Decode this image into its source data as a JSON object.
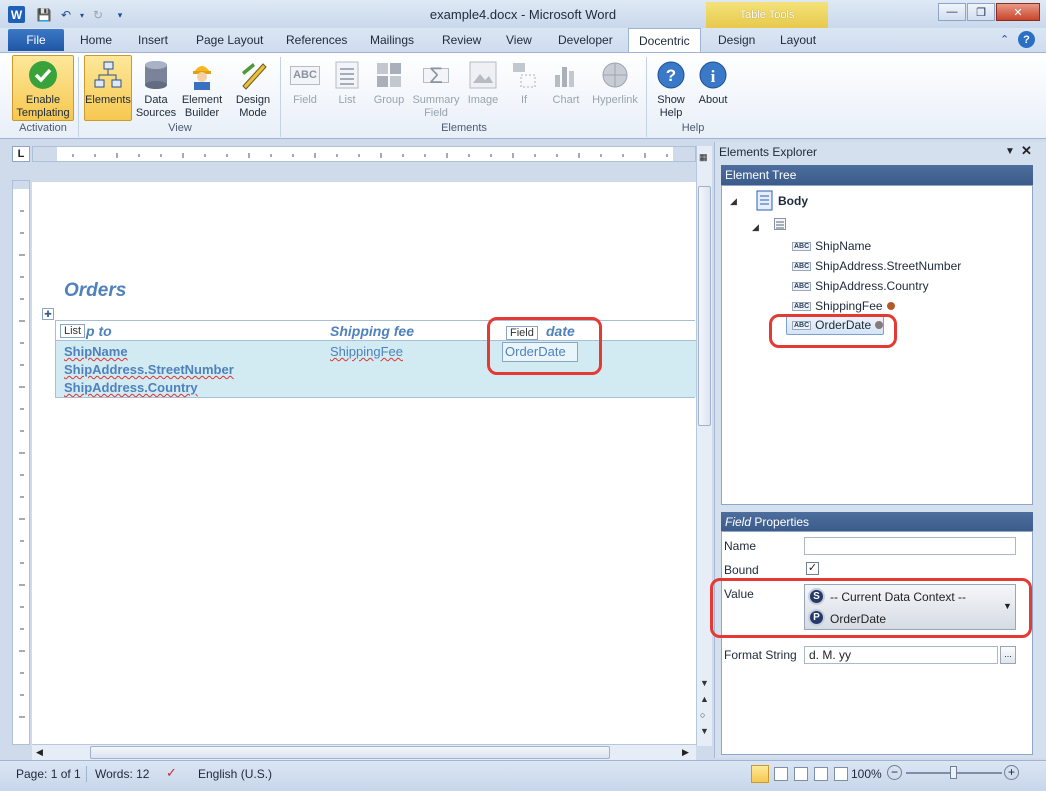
{
  "window": {
    "title": "example4.docx - Microsoft Word",
    "contextual_tab_group": "Table Tools"
  },
  "tabs": [
    "File",
    "Home",
    "Insert",
    "Page Layout",
    "References",
    "Mailings",
    "Review",
    "View",
    "Developer",
    "Docentric",
    "Design",
    "Layout"
  ],
  "ribbon": {
    "groups": {
      "activation": "Activation",
      "view": "View",
      "elements": "Elements",
      "help": "Help"
    },
    "buttons": {
      "enable_templating": [
        "Enable",
        "Templating"
      ],
      "elements": "Elements",
      "data_sources": [
        "Data",
        "Sources"
      ],
      "element_builder": [
        "Element",
        "Builder"
      ],
      "design_mode": [
        "Design",
        "Mode"
      ],
      "field": "Field",
      "list": "List",
      "group": "Group",
      "summary_field": [
        "Summary",
        "Field"
      ],
      "image": "Image",
      "if": "If",
      "chart": "Chart",
      "hyperlink": "Hyperlink",
      "show_help": [
        "Show",
        "Help"
      ],
      "about": "About"
    }
  },
  "document": {
    "heading": "Orders",
    "columns": [
      "p to",
      "Shipping fee",
      "date"
    ],
    "list_tag": "List",
    "field_tag": "Field",
    "ship_fields": [
      "ShipName",
      "ShipAddress.StreetNumber",
      "ShipAddress.Country"
    ],
    "shipping_fee_field": "ShippingFee",
    "order_date_field": "OrderDate"
  },
  "pane": {
    "title": "Elements Explorer",
    "tree_header": "Element Tree",
    "tree_root": "Body",
    "tree_items": [
      "ShipName",
      "ShipAddress.StreetNumber",
      "ShipAddress.Country",
      "ShippingFee",
      "OrderDate"
    ],
    "props_header_italic": "Field",
    "props_header_rest": "Properties",
    "props": {
      "name_label": "Name",
      "name_value": "",
      "bound_label": "Bound",
      "bound_checked": true,
      "value_label": "Value",
      "value_context": "-- Current Data Context --",
      "value_path": "OrderDate",
      "format_label": "Format String",
      "format_value": "d. M. yy"
    }
  },
  "status": {
    "page": "Page: 1 of 1",
    "words": "Words: 12",
    "language": "English (U.S.)",
    "zoom": "100%"
  }
}
